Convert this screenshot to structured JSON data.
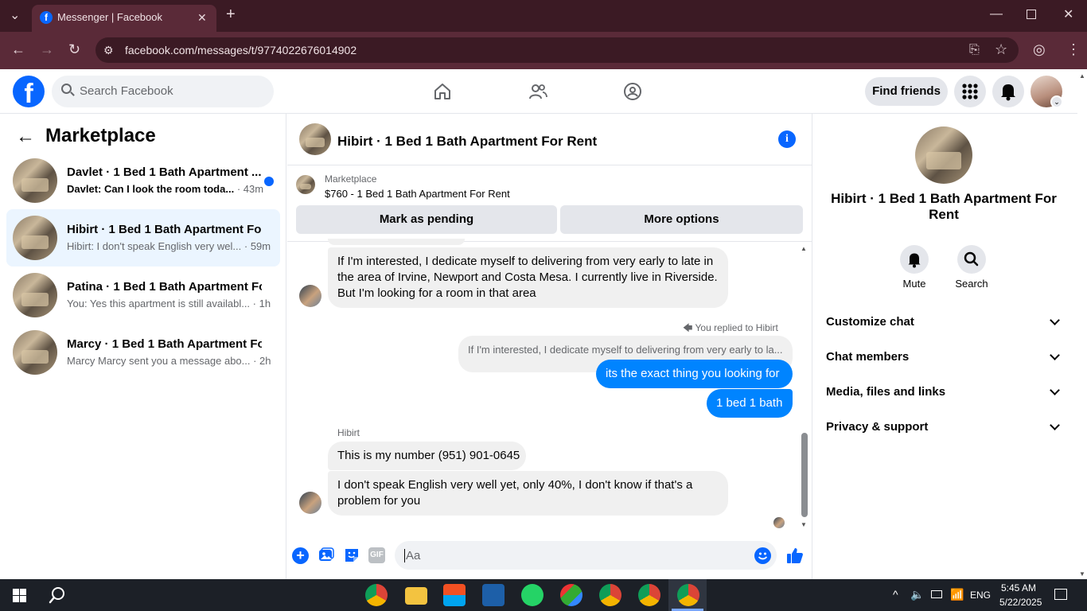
{
  "browser": {
    "tab_title": "Messenger | Facebook",
    "url": "facebook.com/messages/t/9774022676014902"
  },
  "header": {
    "search_placeholder": "Search Facebook",
    "find_friends": "Find friends"
  },
  "sidebar": {
    "title": "Marketplace",
    "conversations": [
      {
        "title": "Davlet · 1 Bed 1 Bath Apartment ...",
        "preview": "Davlet: Can I look the room toda...",
        "time": "· 43m",
        "unread": true
      },
      {
        "title": "Hibirt · 1 Bed 1 Bath Apartment Fo...",
        "preview": "Hibirt: I don't speak English very wel...",
        "time": "· 59m",
        "unread": false
      },
      {
        "title": "Patina · 1 Bed 1 Bath Apartment Fo...",
        "preview": "You: Yes this apartment is still availabl...",
        "time": "· 1h",
        "unread": false
      },
      {
        "title": "Marcy · 1 Bed 1 Bath Apartment Fo...",
        "preview": "Marcy Marcy sent you a message abo...",
        "time": "· 2h",
        "unread": false
      }
    ]
  },
  "chat": {
    "title": "Hibirt · 1 Bed 1 Bath Apartment For Rent",
    "listing_label": "Marketplace",
    "listing_price": "$760 - 1 Bed 1 Bath Apartment For Rent",
    "mark_pending": "Mark as pending",
    "more_options": "More options",
    "messages": {
      "m1": "If I'm interested, I dedicate myself to delivering from very early to late in the area of Irvine, Newport and Costa Mesa. I currently live in Riverside. But I'm looking for a room in that area",
      "reply_label": "You replied to Hibirt",
      "reply_quote": "If I'm interested, I dedicate myself to delivering from very early to la...",
      "m2": "its the exact thing you looking for",
      "m3": "1 bed 1 bath",
      "sender": "Hibirt",
      "m4": "This is my number (951) 901-0645",
      "m5": "I don't speak English very well yet, only 40%, I don't know if that's a problem for you"
    },
    "composer_placeholder": "Aa"
  },
  "info_panel": {
    "title": "Hibirt · 1 Bed 1 Bath Apartment For Rent",
    "mute": "Mute",
    "search": "Search",
    "sections": [
      "Customize chat",
      "Chat members",
      "Media, files and links",
      "Privacy & support"
    ]
  },
  "taskbar": {
    "time": "5:45 AM",
    "date": "5/22/2025",
    "lang": "ENG"
  },
  "colors": {
    "brand": "#0866ff",
    "messenger_blue": "#0084ff",
    "chrome_dark": "#3b1a24",
    "chrome_mid": "#5a2a38"
  }
}
